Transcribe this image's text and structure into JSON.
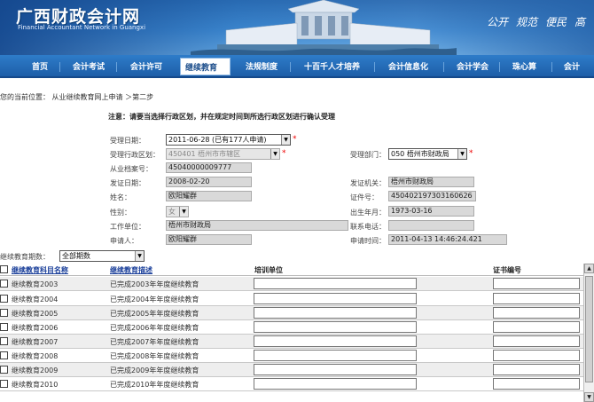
{
  "site": {
    "title": "广西财政会计网",
    "subtitle": "Financial Accountant Network in Guangxi",
    "motto": [
      "公开",
      "规范",
      "便民",
      "高"
    ]
  },
  "nav": [
    {
      "label": "首页"
    },
    {
      "label": "会计考试"
    },
    {
      "label": "会计许可"
    },
    {
      "label": "继续教育",
      "active": true
    },
    {
      "label": "法规制度"
    },
    {
      "label": "十百千人才培养"
    },
    {
      "label": "会计信息化"
    },
    {
      "label": "会计学会"
    },
    {
      "label": "珠心算"
    },
    {
      "label": "会计"
    }
  ],
  "breadcrumb": "您的当前位置： 从业继续教育网上申请 ＞第二步",
  "notice": "注意：请要当选择行政区划，并在规定时间到所选行政区划进行确认受理",
  "form": {
    "accept_date_label": "受理日期：",
    "accept_date_value": "2011-06-28 (已有177人申请)",
    "region_label": "受理行政区划：",
    "region_value": "450401 梧州市市辖区",
    "dept_label": "受理部门：",
    "dept_value": "050 梧州市财政局",
    "archive_label": "从业档案号：",
    "archive_value": "45040000009777",
    "issue_date_label": "发证日期：",
    "issue_date_value": "2008-02-20",
    "issue_org_label": "发证机关：",
    "issue_org_value": "梧州市财政局",
    "name_label": "姓名：",
    "name_value": "欧阳耀群",
    "id_label": "证件号：",
    "id_value": "450402197303160626",
    "gender_label": "性别：",
    "gender_value": "女",
    "birth_label": "出生年月：",
    "birth_value": "1973-03-16",
    "work_label": "工作单位：",
    "work_value": "梧州市财政局",
    "phone_label": "联系电话：",
    "phone_value": "",
    "applicant_label": "申请人：",
    "applicant_value": "欧阳耀群",
    "apply_time_label": "申请时间：",
    "apply_time_value": "2011-04-13 14:46:24.421"
  },
  "period": {
    "label": "继续教育期数：",
    "value": "全部期数"
  },
  "grid": {
    "headers": [
      "继续教育科目名称",
      "继续教育描述",
      "培训单位",
      "证书编号"
    ],
    "rows": [
      {
        "name": "继续教育2003",
        "desc": "已完成2003年年度继续教育"
      },
      {
        "name": "继续教育2004",
        "desc": "已完成2004年年度继续教育"
      },
      {
        "name": "继续教育2005",
        "desc": "已完成2005年年度继续教育"
      },
      {
        "name": "继续教育2006",
        "desc": "已完成2006年年度继续教育"
      },
      {
        "name": "继续教育2007",
        "desc": "已完成2007年年度继续教育"
      },
      {
        "name": "继续教育2008",
        "desc": "已完成2008年年度继续教育"
      },
      {
        "name": "继续教育2009",
        "desc": "已完成2009年年度继续教育"
      },
      {
        "name": "继续教育2010",
        "desc": "已完成2010年年度继续教育"
      }
    ]
  },
  "colors": {
    "nav_bg": "#1d5ea8",
    "required": "#ee0000",
    "link": "#1a3f9a"
  }
}
